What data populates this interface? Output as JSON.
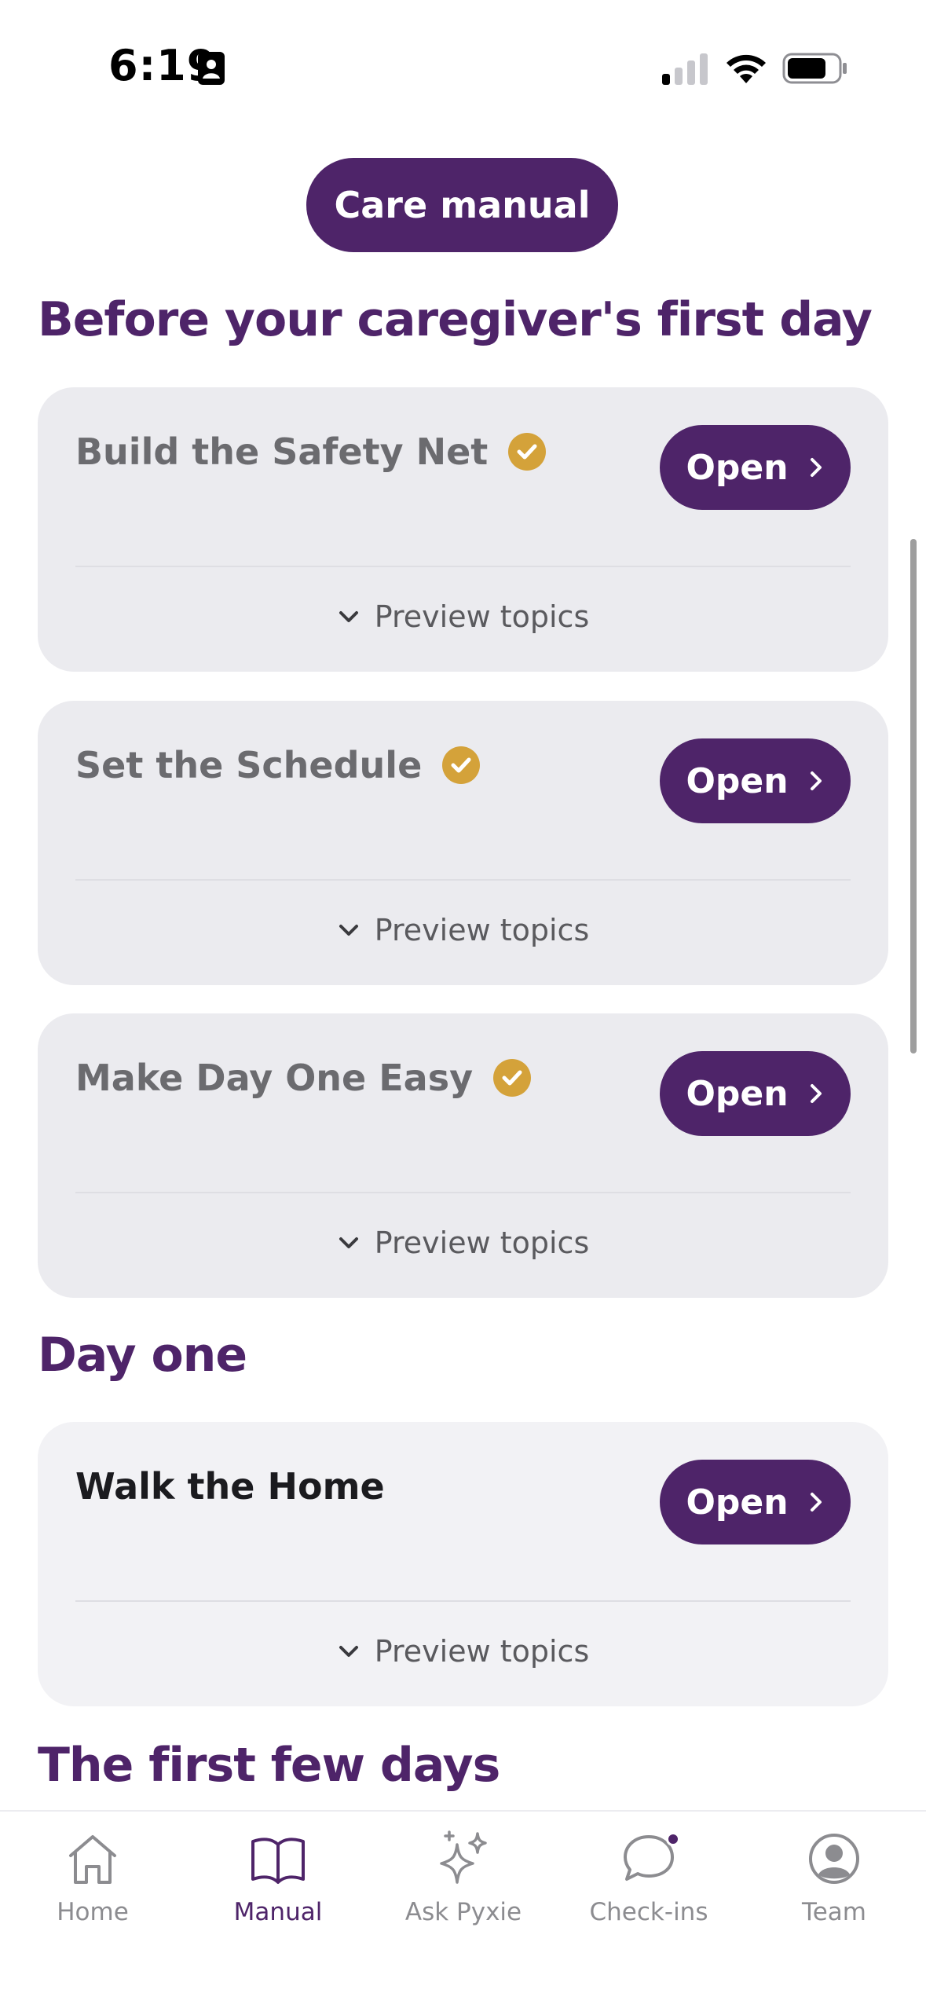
{
  "status": {
    "time": "6:19",
    "icons": [
      "id-card-icon",
      "cellular-signal-icon",
      "wifi-icon",
      "battery-icon"
    ]
  },
  "header": {
    "pill_label": "Care manual"
  },
  "sections": [
    {
      "title": "Before your caregiver's first day",
      "cards": [
        {
          "title": "Build the Safety Net",
          "completed": true,
          "open_label": "Open",
          "preview_label": "Preview topics"
        },
        {
          "title": "Set the Schedule",
          "completed": true,
          "open_label": "Open",
          "preview_label": "Preview topics"
        },
        {
          "title": "Make Day One Easy",
          "completed": true,
          "open_label": "Open",
          "preview_label": "Preview topics"
        }
      ]
    },
    {
      "title": "Day one",
      "cards": [
        {
          "title": "Walk the Home",
          "completed": false,
          "open_label": "Open",
          "preview_label": "Preview topics"
        }
      ]
    },
    {
      "title": "The first few days",
      "cards": []
    }
  ],
  "tabbar": {
    "tabs": [
      {
        "label": "Home",
        "icon": "home-icon",
        "selected": false
      },
      {
        "label": "Manual",
        "icon": "book-icon",
        "selected": true
      },
      {
        "label": "Ask Pyxie",
        "icon": "sparkles-icon",
        "selected": false
      },
      {
        "label": "Check-ins",
        "icon": "chat-bubble-icon",
        "selected": false,
        "notification": true
      },
      {
        "label": "Team",
        "icon": "person-circle-icon",
        "selected": false
      }
    ]
  },
  "colors": {
    "brand": "#4e2469",
    "check": "#d4a23a",
    "card_bg": "#ebebef",
    "muted_text": "#6b6b6f"
  }
}
